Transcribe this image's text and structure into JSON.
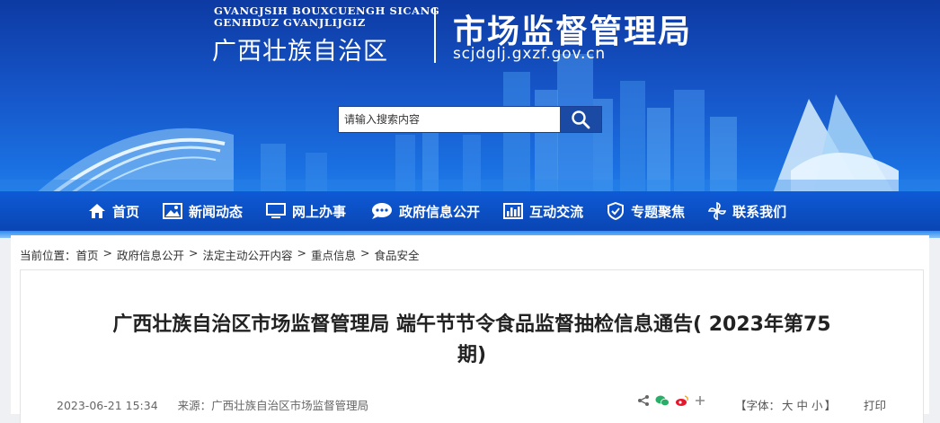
{
  "header": {
    "pinyin_line1": "GVANGJSIH BOUXCUENGH SICANG",
    "pinyin_line2": "GENHDUZ GVANJLIJGIZ",
    "region_name": "广西壮族自治区",
    "agency_title": "市场监督管理局",
    "site_url": "scjdglj.gxzf.gov.cn"
  },
  "search": {
    "placeholder": "请输入搜索内容"
  },
  "nav": {
    "items": [
      {
        "label": "首页",
        "icon": "home-icon"
      },
      {
        "label": "新闻动态",
        "icon": "image-icon"
      },
      {
        "label": "网上办事",
        "icon": "monitor-icon"
      },
      {
        "label": "政府信息公开",
        "icon": "speech-bubble-icon"
      },
      {
        "label": "互动交流",
        "icon": "bar-chart-icon"
      },
      {
        "label": "专题聚焦",
        "icon": "shield-icon"
      },
      {
        "label": "联系我们",
        "icon": "pinwheel-icon"
      }
    ]
  },
  "breadcrumb": {
    "prefix": "当前位置：",
    "items": [
      "首页",
      "政府信息公开",
      "法定主动公开内容",
      "重点信息",
      "食品安全"
    ],
    "separator": ">"
  },
  "article": {
    "title_line1": "广西壮族自治区市场监督管理局 端午节节令食品监督抽检信息通告( 2023年第75",
    "title_line2": "期)",
    "date": "2023-06-21 15:34",
    "source": "来源：广西壮族自治区市场监督管理局",
    "font_label": "【字体：",
    "font_large": "大",
    "font_medium": "中",
    "font_small": "小",
    "font_close": "】",
    "print": "打印"
  },
  "colors": {
    "banner": "#1656c9",
    "nav": "#0b4fc4",
    "search_button": "#1a4aa3"
  }
}
